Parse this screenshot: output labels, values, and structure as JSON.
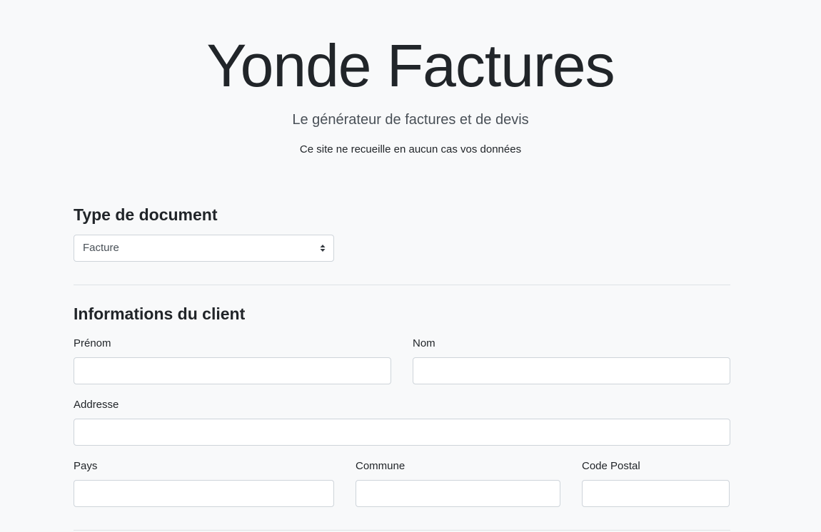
{
  "hero": {
    "title": "Yonde Factures",
    "subtitle": "Le générateur de factures et de devis",
    "note": "Ce site ne recueille en aucun cas vos données"
  },
  "document_type": {
    "heading": "Type de document",
    "selected": "Facture"
  },
  "client": {
    "heading": "Informations du client",
    "fields": {
      "prenom": {
        "label": "Prénom",
        "value": ""
      },
      "nom": {
        "label": "Nom",
        "value": ""
      },
      "adresse": {
        "label": "Addresse",
        "value": ""
      },
      "pays": {
        "label": "Pays",
        "value": ""
      },
      "commune": {
        "label": "Commune",
        "value": ""
      },
      "code_postal": {
        "label": "Code Postal",
        "value": ""
      }
    }
  },
  "icons": {
    "select_arrow": "sort-arrows-icon"
  },
  "colors": {
    "background": "#f8f9fa",
    "text": "#212529",
    "border": "#ced4da",
    "divider": "#dee2e6"
  }
}
